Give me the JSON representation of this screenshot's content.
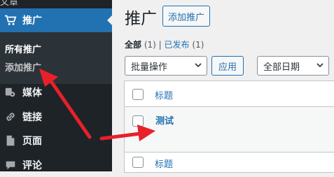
{
  "sidebar": {
    "top_partial_label": "文章",
    "active_item": {
      "label": "推广",
      "icon": "cart-icon"
    },
    "submenu": [
      {
        "label": "所有推广",
        "current": true
      },
      {
        "label": "添加推广",
        "current": false
      }
    ],
    "items": [
      {
        "label": "媒体",
        "icon": "media-icon"
      },
      {
        "label": "链接",
        "icon": "link-icon"
      },
      {
        "label": "页面",
        "icon": "page-icon"
      },
      {
        "label": "评论",
        "icon": "comment-icon"
      }
    ]
  },
  "main": {
    "title": "推广",
    "add_new_label": "添加推广",
    "filters": {
      "all_label": "全部",
      "all_count": "(1)",
      "separator": "|",
      "published_label": "已发布",
      "published_count": "(1)"
    },
    "bulk_action": {
      "selected": "批量操作"
    },
    "apply_label": "应用",
    "date_filter": {
      "selected": "全部日期"
    },
    "table": {
      "column_title": "标题",
      "rows": [
        {
          "title": "测试"
        }
      ],
      "footer_title": "标题"
    }
  },
  "colors": {
    "sidebar_bg": "#1d2327",
    "submenu_bg": "#2c3338",
    "accent": "#2271b1",
    "annotation_arrow": "#e8202a"
  }
}
